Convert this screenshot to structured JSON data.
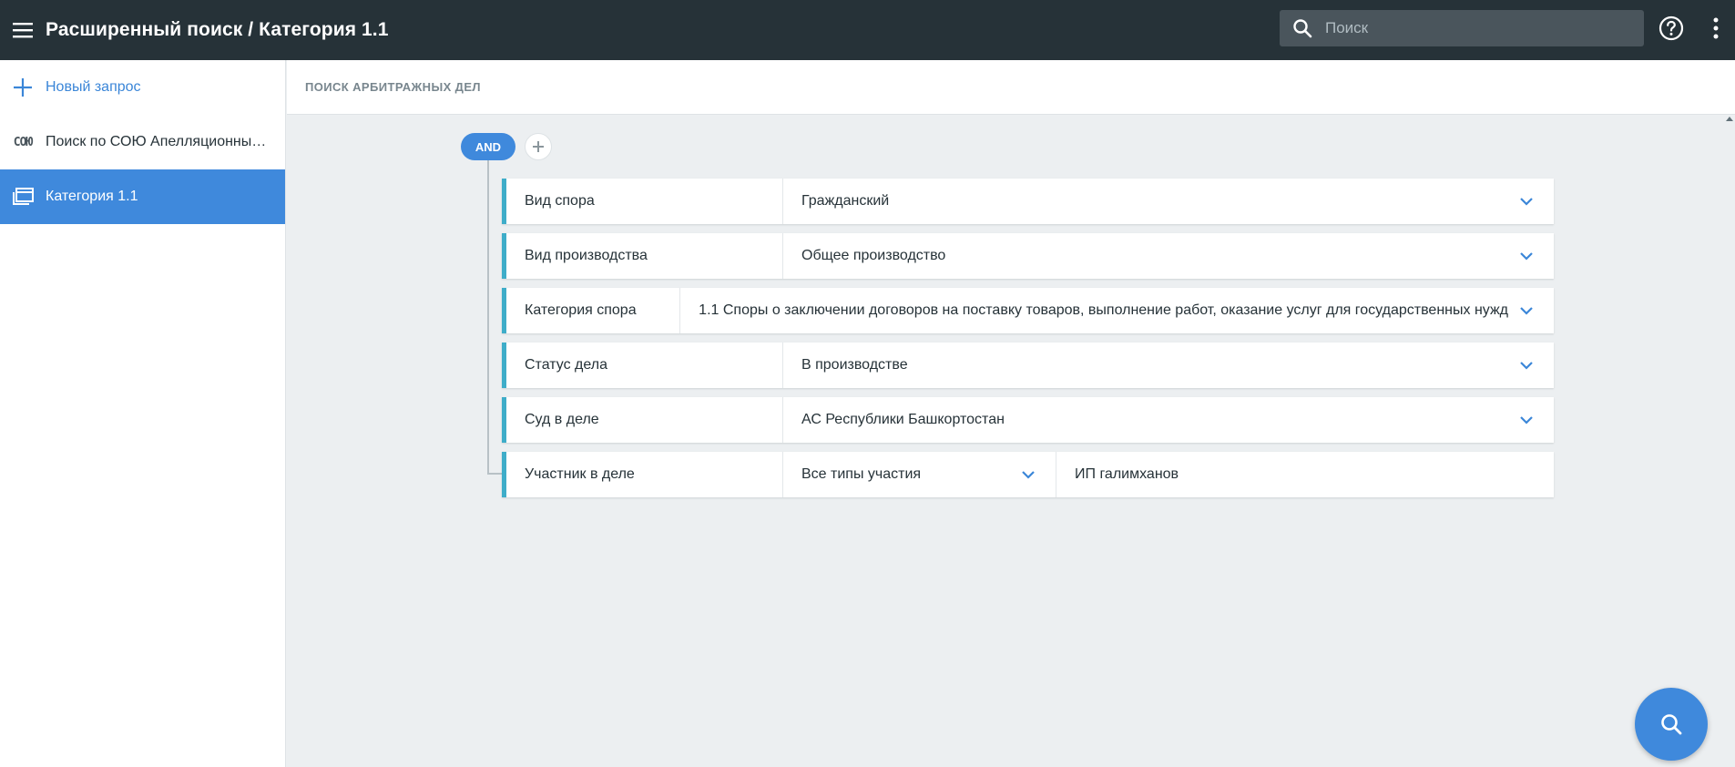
{
  "header": {
    "title": "Расширенный поиск / Категория 1.1",
    "search_placeholder": "Поиск"
  },
  "sidebar": {
    "items": [
      {
        "label": "Новый запрос",
        "icon": "plus-icon"
      },
      {
        "label": "Поиск по СОЮ Апелляционные суды",
        "icon": "coyu-icon",
        "icon_text": "СОЮ"
      },
      {
        "label": "Категория 1.1",
        "icon": "folders-icon",
        "active": true
      }
    ]
  },
  "main": {
    "section_title": "ПОИСК АРБИТРАЖНЫХ ДЕЛ",
    "operator": "AND",
    "conditions": [
      {
        "field": "Вид спора",
        "value": "Гражданский"
      },
      {
        "field": "Вид производства",
        "value": "Общее производство"
      },
      {
        "field": "Категория спора",
        "value": "1.1 Споры о заключении договоров на поставку товаров, выполнение работ, оказание услуг для государственных нужд"
      },
      {
        "field": "Статус дела",
        "value": "В производстве"
      },
      {
        "field": "Суд в деле",
        "value": "АС Республики Башкортостан"
      },
      {
        "field": "Участник в деле",
        "value": "Все типы участия",
        "text_value": "ИП галимханов"
      }
    ]
  },
  "colors": {
    "topbar": "#263238",
    "accent": "#3f89dc",
    "row_marker": "#3eadc9"
  }
}
